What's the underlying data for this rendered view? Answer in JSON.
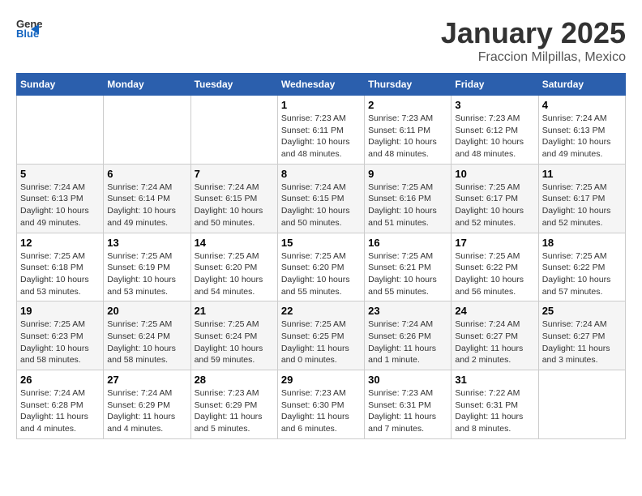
{
  "header": {
    "logo_general": "General",
    "logo_blue": "Blue",
    "title": "January 2025",
    "subtitle": "Fraccion Milpillas, Mexico"
  },
  "days_of_week": [
    "Sunday",
    "Monday",
    "Tuesday",
    "Wednesday",
    "Thursday",
    "Friday",
    "Saturday"
  ],
  "weeks": [
    [
      {
        "day": "",
        "sunrise": "",
        "sunset": "",
        "daylight": ""
      },
      {
        "day": "",
        "sunrise": "",
        "sunset": "",
        "daylight": ""
      },
      {
        "day": "",
        "sunrise": "",
        "sunset": "",
        "daylight": ""
      },
      {
        "day": "1",
        "sunrise": "Sunrise: 7:23 AM",
        "sunset": "Sunset: 6:11 PM",
        "daylight": "Daylight: 10 hours and 48 minutes."
      },
      {
        "day": "2",
        "sunrise": "Sunrise: 7:23 AM",
        "sunset": "Sunset: 6:11 PM",
        "daylight": "Daylight: 10 hours and 48 minutes."
      },
      {
        "day": "3",
        "sunrise": "Sunrise: 7:23 AM",
        "sunset": "Sunset: 6:12 PM",
        "daylight": "Daylight: 10 hours and 48 minutes."
      },
      {
        "day": "4",
        "sunrise": "Sunrise: 7:24 AM",
        "sunset": "Sunset: 6:13 PM",
        "daylight": "Daylight: 10 hours and 49 minutes."
      }
    ],
    [
      {
        "day": "5",
        "sunrise": "Sunrise: 7:24 AM",
        "sunset": "Sunset: 6:13 PM",
        "daylight": "Daylight: 10 hours and 49 minutes."
      },
      {
        "day": "6",
        "sunrise": "Sunrise: 7:24 AM",
        "sunset": "Sunset: 6:14 PM",
        "daylight": "Daylight: 10 hours and 49 minutes."
      },
      {
        "day": "7",
        "sunrise": "Sunrise: 7:24 AM",
        "sunset": "Sunset: 6:15 PM",
        "daylight": "Daylight: 10 hours and 50 minutes."
      },
      {
        "day": "8",
        "sunrise": "Sunrise: 7:24 AM",
        "sunset": "Sunset: 6:15 PM",
        "daylight": "Daylight: 10 hours and 50 minutes."
      },
      {
        "day": "9",
        "sunrise": "Sunrise: 7:25 AM",
        "sunset": "Sunset: 6:16 PM",
        "daylight": "Daylight: 10 hours and 51 minutes."
      },
      {
        "day": "10",
        "sunrise": "Sunrise: 7:25 AM",
        "sunset": "Sunset: 6:17 PM",
        "daylight": "Daylight: 10 hours and 52 minutes."
      },
      {
        "day": "11",
        "sunrise": "Sunrise: 7:25 AM",
        "sunset": "Sunset: 6:17 PM",
        "daylight": "Daylight: 10 hours and 52 minutes."
      }
    ],
    [
      {
        "day": "12",
        "sunrise": "Sunrise: 7:25 AM",
        "sunset": "Sunset: 6:18 PM",
        "daylight": "Daylight: 10 hours and 53 minutes."
      },
      {
        "day": "13",
        "sunrise": "Sunrise: 7:25 AM",
        "sunset": "Sunset: 6:19 PM",
        "daylight": "Daylight: 10 hours and 53 minutes."
      },
      {
        "day": "14",
        "sunrise": "Sunrise: 7:25 AM",
        "sunset": "Sunset: 6:20 PM",
        "daylight": "Daylight: 10 hours and 54 minutes."
      },
      {
        "day": "15",
        "sunrise": "Sunrise: 7:25 AM",
        "sunset": "Sunset: 6:20 PM",
        "daylight": "Daylight: 10 hours and 55 minutes."
      },
      {
        "day": "16",
        "sunrise": "Sunrise: 7:25 AM",
        "sunset": "Sunset: 6:21 PM",
        "daylight": "Daylight: 10 hours and 55 minutes."
      },
      {
        "day": "17",
        "sunrise": "Sunrise: 7:25 AM",
        "sunset": "Sunset: 6:22 PM",
        "daylight": "Daylight: 10 hours and 56 minutes."
      },
      {
        "day": "18",
        "sunrise": "Sunrise: 7:25 AM",
        "sunset": "Sunset: 6:22 PM",
        "daylight": "Daylight: 10 hours and 57 minutes."
      }
    ],
    [
      {
        "day": "19",
        "sunrise": "Sunrise: 7:25 AM",
        "sunset": "Sunset: 6:23 PM",
        "daylight": "Daylight: 10 hours and 58 minutes."
      },
      {
        "day": "20",
        "sunrise": "Sunrise: 7:25 AM",
        "sunset": "Sunset: 6:24 PM",
        "daylight": "Daylight: 10 hours and 58 minutes."
      },
      {
        "day": "21",
        "sunrise": "Sunrise: 7:25 AM",
        "sunset": "Sunset: 6:24 PM",
        "daylight": "Daylight: 10 hours and 59 minutes."
      },
      {
        "day": "22",
        "sunrise": "Sunrise: 7:25 AM",
        "sunset": "Sunset: 6:25 PM",
        "daylight": "Daylight: 11 hours and 0 minutes."
      },
      {
        "day": "23",
        "sunrise": "Sunrise: 7:24 AM",
        "sunset": "Sunset: 6:26 PM",
        "daylight": "Daylight: 11 hours and 1 minute."
      },
      {
        "day": "24",
        "sunrise": "Sunrise: 7:24 AM",
        "sunset": "Sunset: 6:27 PM",
        "daylight": "Daylight: 11 hours and 2 minutes."
      },
      {
        "day": "25",
        "sunrise": "Sunrise: 7:24 AM",
        "sunset": "Sunset: 6:27 PM",
        "daylight": "Daylight: 11 hours and 3 minutes."
      }
    ],
    [
      {
        "day": "26",
        "sunrise": "Sunrise: 7:24 AM",
        "sunset": "Sunset: 6:28 PM",
        "daylight": "Daylight: 11 hours and 4 minutes."
      },
      {
        "day": "27",
        "sunrise": "Sunrise: 7:24 AM",
        "sunset": "Sunset: 6:29 PM",
        "daylight": "Daylight: 11 hours and 4 minutes."
      },
      {
        "day": "28",
        "sunrise": "Sunrise: 7:23 AM",
        "sunset": "Sunset: 6:29 PM",
        "daylight": "Daylight: 11 hours and 5 minutes."
      },
      {
        "day": "29",
        "sunrise": "Sunrise: 7:23 AM",
        "sunset": "Sunset: 6:30 PM",
        "daylight": "Daylight: 11 hours and 6 minutes."
      },
      {
        "day": "30",
        "sunrise": "Sunrise: 7:23 AM",
        "sunset": "Sunset: 6:31 PM",
        "daylight": "Daylight: 11 hours and 7 minutes."
      },
      {
        "day": "31",
        "sunrise": "Sunrise: 7:22 AM",
        "sunset": "Sunset: 6:31 PM",
        "daylight": "Daylight: 11 hours and 8 minutes."
      },
      {
        "day": "",
        "sunrise": "",
        "sunset": "",
        "daylight": ""
      }
    ]
  ]
}
